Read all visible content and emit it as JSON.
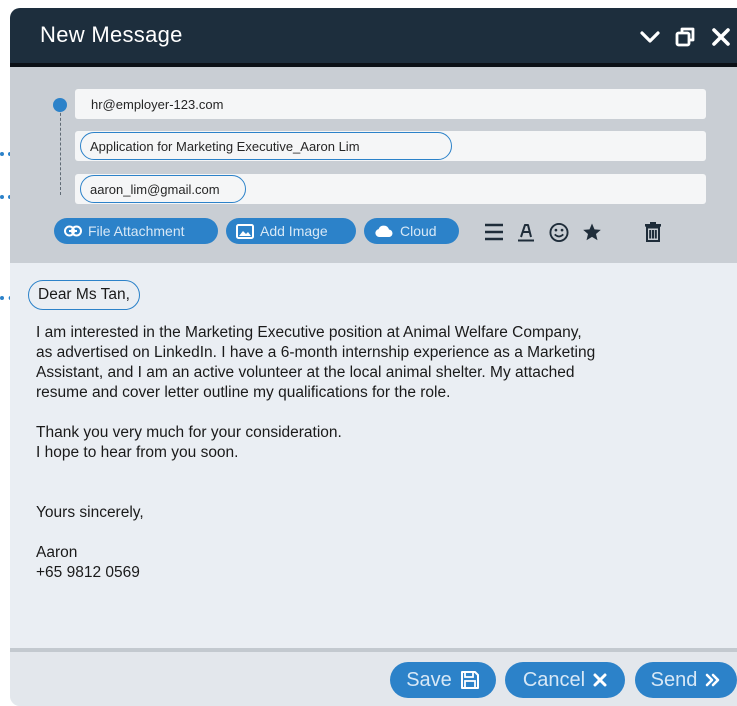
{
  "window": {
    "title": "New Message",
    "controls": [
      "chevron-down-icon",
      "restore-window-icon",
      "close-icon"
    ]
  },
  "fields": {
    "to": "hr@employer-123.com",
    "subject": "Application for Marketing Executive_Aaron Lim",
    "from": "aaron_lim@gmail.com"
  },
  "toolbar": {
    "buttons": [
      {
        "label": "File Attachment",
        "icon": "link-icon"
      },
      {
        "label": "Add Image",
        "icon": "image-icon"
      },
      {
        "label": "Cloud",
        "icon": "cloud-icon"
      }
    ],
    "icons": [
      "menu-icon",
      "text-format-icon",
      "emoji-icon",
      "star-icon",
      "trash-icon"
    ]
  },
  "body": {
    "salutation": "Dear Ms Tan,",
    "paragraph1": [
      "I am interested in the Marketing Executive position at Animal Welfare Company,",
      "as advertised on LinkedIn. I have a 6-month internship experience as a Marketing",
      "Assistant, and I am an active volunteer at the local animal shelter. My attached",
      "resume and cover letter outline my qualifications for the role."
    ],
    "paragraph2": [
      "Thank you very much for your consideration.",
      "I hope to hear from you soon."
    ],
    "closing": "Yours sincerely,",
    "signature_name": "Aaron",
    "signature_phone": "+65 9812 0569"
  },
  "footer": {
    "save_label": "Save",
    "cancel_label": "Cancel",
    "send_label": "Send"
  },
  "colors": {
    "accent": "#2c82c9",
    "titlebar": "#1d2e3d",
    "header_bg": "#c9ced4",
    "body_bg": "#eaeef3"
  }
}
